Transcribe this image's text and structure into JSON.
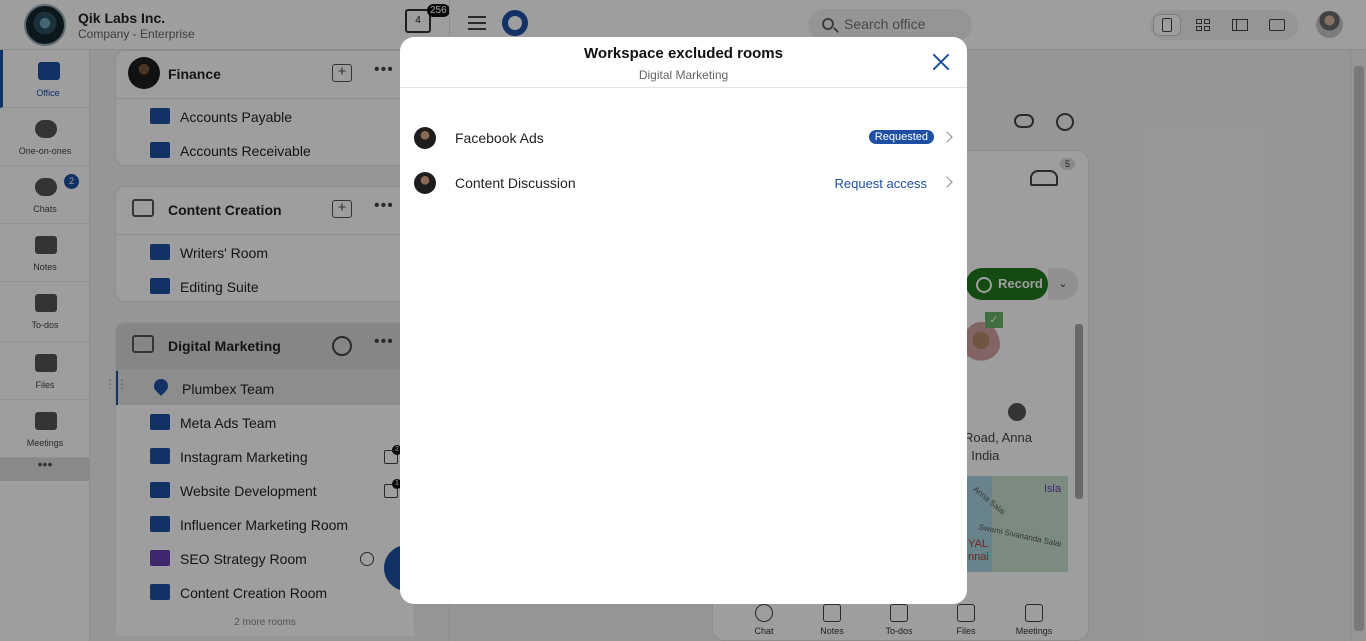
{
  "header": {
    "org_name": "Qik Labs Inc.",
    "org_plan": "Company - Enterprise",
    "calendar_day": "4",
    "calendar_badge": "256",
    "search_placeholder": "Search office"
  },
  "leftnav": {
    "items": [
      {
        "label": "Office",
        "icon": "briefcase-icon",
        "active": true
      },
      {
        "label": "One-on-ones",
        "icon": "people-icon"
      },
      {
        "label": "Chats",
        "icon": "chat-icon",
        "badge": "2"
      },
      {
        "label": "Notes",
        "icon": "notes-icon"
      },
      {
        "label": "To-dos",
        "icon": "checkbox-icon"
      },
      {
        "label": "Files",
        "icon": "files-icon"
      },
      {
        "label": "Meetings",
        "icon": "meetings-icon"
      }
    ],
    "more": "•••"
  },
  "groups": {
    "finance": {
      "title": "Finance",
      "rooms": [
        "Accounts Payable",
        "Accounts Receivable"
      ]
    },
    "content": {
      "title": "Content Creation",
      "rooms": [
        "Writers' Room",
        "Editing Suite"
      ]
    },
    "marketing": {
      "title": "Digital Marketing",
      "rooms": [
        "Plumbex Team",
        "Meta Ads Team",
        "Instagram Marketing",
        "Website Development",
        "Influencer Marketing Room",
        "SEO Strategy Room",
        "Content Creation Room"
      ],
      "more_rooms": "2 more rooms",
      "instagram_badge": "2",
      "website_badge": "1"
    }
  },
  "room_panel": {
    "members_count": "5",
    "record_label": "Record",
    "address_line1": "Road, Anna",
    "address_line2": ", India",
    "map_label_1": "Isla",
    "map_label_2": "Anna Salai",
    "map_label_3": "Swami Sivananda Salai",
    "map_red_label_1": "YAL",
    "map_red_label_2": "nnai",
    "bottom_tabs": [
      "Chat",
      "Notes",
      "To-dos",
      "Files",
      "Meetings"
    ]
  },
  "modal": {
    "title": "Workspace excluded rooms",
    "subtitle": "Digital Marketing",
    "rooms": [
      {
        "name": "Facebook Ads",
        "status": "Requested"
      },
      {
        "name": "Content Discussion",
        "action": "Request access"
      }
    ]
  },
  "colors": {
    "accent": "#1e4fa3",
    "record_green": "#1f7a1f"
  }
}
